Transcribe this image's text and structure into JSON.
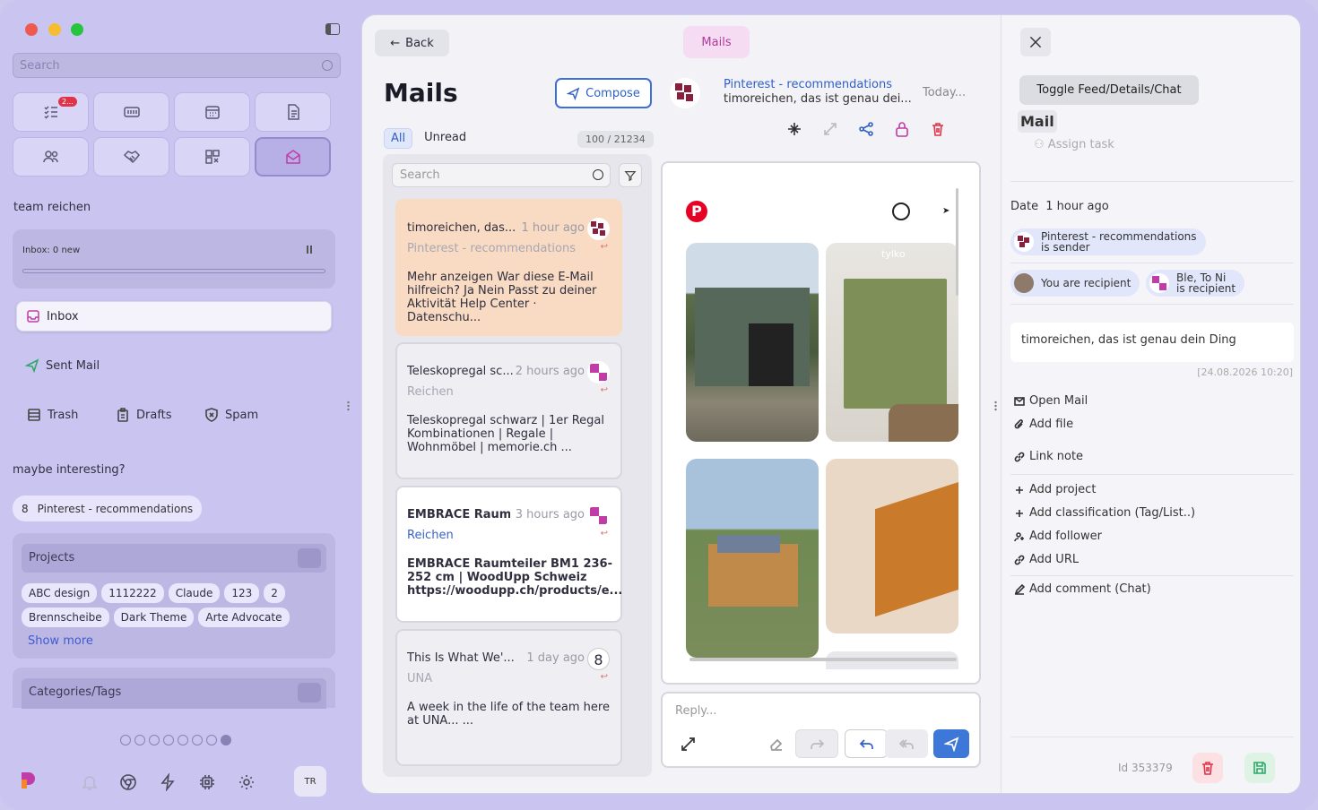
{
  "sidebar": {
    "search_placeholder": "Search",
    "tile_badge": "2...",
    "workspace": "team reichen",
    "inbox_status": "Inbox: 0 new",
    "folders": {
      "inbox": "Inbox",
      "sent": "Sent Mail",
      "trash": "Trash",
      "drafts": "Drafts",
      "spam": "Spam"
    },
    "maybe_title": "maybe interesting?",
    "suggest": {
      "count": "8",
      "label": "Pinterest - recommendations"
    },
    "projects_title": "Projects",
    "projects": [
      "ABC design",
      "1112222",
      "Claude",
      "123",
      "2",
      "Brennscheibe",
      "Dark Theme",
      "Arte Advocate"
    ],
    "show_more": "Show more",
    "categories_title": "Categories/Tags",
    "user_initials": "TR"
  },
  "main": {
    "back_label": "Back",
    "tab_label": "Mails",
    "title": "Mails",
    "compose_label": "Compose",
    "filters": [
      "All",
      "Unread"
    ],
    "count": "100 / 21234",
    "search_placeholder": "Search",
    "mails": [
      {
        "from": "timoreichen, das...",
        "time": "1 hour ago",
        "source": "Pinterest - recommendations",
        "preview": "Mehr anzeigen War diese E-Mail hilfreich? Ja Nein Passt zu deiner Aktivität Help Center · Datenschu..."
      },
      {
        "from": "Teleskopregal sc...",
        "time": "2 hours ago",
        "source": "Reichen",
        "preview": "Teleskopregal schwarz | 1er Regal Kombinationen | Regale | Wohnmöbel | memorie.ch ..."
      },
      {
        "from": "EMBRACE Raum...",
        "time": "3 hours ago",
        "source": "Reichen",
        "preview": "EMBRACE Raumteiler BM1 236-252 cm | WoodUpp Schweiz https://woodupp.ch/products/e..."
      },
      {
        "from": "This Is What We'...",
        "time": "1 day ago",
        "source": "UNA",
        "preview": "A week in the life of the team here at UNA... ..."
      }
    ],
    "preview": {
      "from": "Pinterest - recommendations",
      "subject": "timoreichen, das ist genau dei...",
      "date": "Today...",
      "image_caption": "tylko"
    },
    "reply_placeholder": "Reply..."
  },
  "details": {
    "toggle_label": "Toggle Feed/Details/Chat",
    "section_title": "Mail",
    "assign_label": "Assign task",
    "date_label": "Date",
    "date_value": "1 hour ago",
    "sender": {
      "line1": "Pinterest - recommendations",
      "line2": "is sender"
    },
    "recipient_you": "You are recipient",
    "recipient_other": {
      "line1": "Ble, To Ni",
      "line2": "is recipient"
    },
    "message": "timoreichen, das ist genau dein Ding",
    "timestamp": "[24.08.2026 10:20]",
    "links": {
      "open_mail": "Open Mail",
      "add_file": "Add file",
      "link_note": "Link note",
      "add_project": "Add project",
      "add_classification": "Add classification (Tag/List..)",
      "add_follower": "Add follower",
      "add_url": "Add URL",
      "add_comment": "Add comment (Chat)"
    },
    "id_label": "Id 353379"
  },
  "colors": {
    "accent": "#2f5ec7",
    "brand": "#c03ca6",
    "danger": "#e0334a",
    "selected_card": "#f9dbc3"
  }
}
